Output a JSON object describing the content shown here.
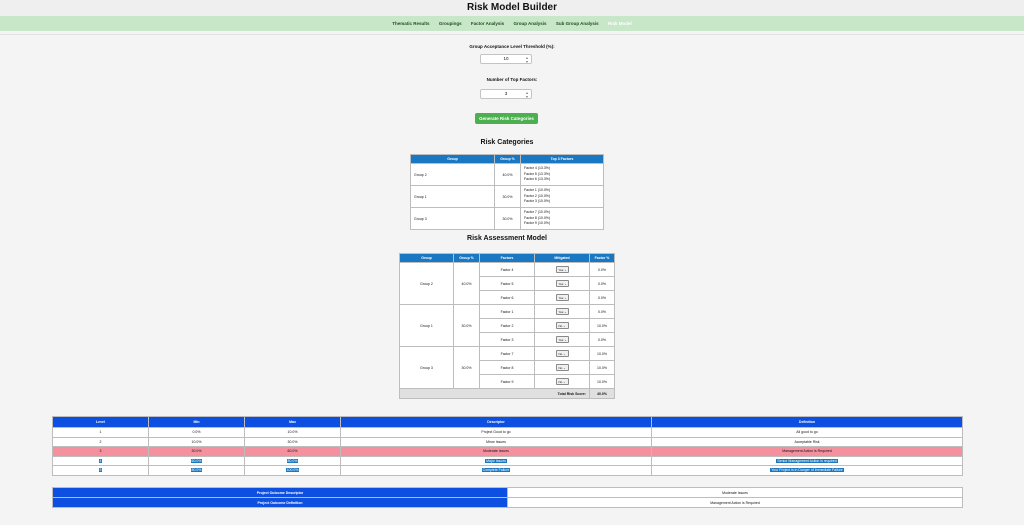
{
  "app": {
    "title": "Risk Model Builder"
  },
  "nav": {
    "tabs": [
      "Thematic Results",
      "Groupings",
      "Factor Analysis",
      "Group Analysis",
      "Sub Group Analysis",
      "Risk Model"
    ],
    "active": "Risk Model"
  },
  "form": {
    "threshold_label": "Group Acceptance Level Threshold (%):",
    "threshold_value": "10",
    "top_factors_label": "Number of Top Factors:",
    "top_factors_value": "3",
    "generate_label": "Generate Risk Categories"
  },
  "categories": {
    "title": "Risk Categories",
    "headers": [
      "Group",
      "Group %",
      "Top 3 Factors"
    ],
    "rows": [
      {
        "group": "Group 2",
        "pct": "40.0%",
        "factors": [
          "Factor 4 (13.3%)",
          "Factor 5 (13.3%)",
          "Factor 6 (13.3%)"
        ]
      },
      {
        "group": "Group 1",
        "pct": "30.0%",
        "factors": [
          "Factor 1 (10.0%)",
          "Factor 2 (10.0%)",
          "Factor 3 (10.0%)"
        ]
      },
      {
        "group": "Group 3",
        "pct": "30.0%",
        "factors": [
          "Factor 7 (10.0%)",
          "Factor 8 (10.0%)",
          "Factor 9 (10.0%)"
        ]
      }
    ]
  },
  "assessment": {
    "title": "Risk Assessment Model",
    "headers": [
      "Group",
      "Group %",
      "Factors",
      "Mitigated",
      "Factor %"
    ],
    "groups": [
      {
        "group": "Group 2",
        "pct": "40.0%",
        "factors": [
          {
            "name": "Factor 4",
            "mitigated": "Yes",
            "pct": "0.0%"
          },
          {
            "name": "Factor 5",
            "mitigated": "Yes",
            "pct": "0.0%"
          },
          {
            "name": "Factor 6",
            "mitigated": "Yes",
            "pct": "0.0%"
          }
        ]
      },
      {
        "group": "Group 1",
        "pct": "30.0%",
        "factors": [
          {
            "name": "Factor 1",
            "mitigated": "Yes",
            "pct": "0.0%"
          },
          {
            "name": "Factor 2",
            "mitigated": "No",
            "pct": "10.0%"
          },
          {
            "name": "Factor 3",
            "mitigated": "Yes",
            "pct": "0.0%"
          }
        ]
      },
      {
        "group": "Group 3",
        "pct": "30.0%",
        "factors": [
          {
            "name": "Factor 7",
            "mitigated": "No",
            "pct": "10.0%"
          },
          {
            "name": "Factor 8",
            "mitigated": "No",
            "pct": "10.0%"
          },
          {
            "name": "Factor 9",
            "mitigated": "No",
            "pct": "10.0%"
          }
        ]
      }
    ],
    "total_label": "Total Risk Score:",
    "total_value": "40.0%"
  },
  "levels": {
    "headers": [
      "Level",
      "Min",
      "Max",
      "Descriptor",
      "Definition"
    ],
    "rows": [
      [
        "1",
        "0.0%",
        "10.0%",
        "Project Good to go",
        "All good to go"
      ],
      [
        "2",
        "10.0%",
        "30.0%",
        "Minor Issues",
        "Acceptable Risk"
      ],
      [
        "3",
        "30.0%",
        "60.0%",
        "Moderate Issues",
        "Management Action is Required"
      ],
      [
        "4",
        "60.0%",
        "80.0%",
        "Major Issues",
        "Senior Management Action is required"
      ],
      [
        "5",
        "80.0%",
        "100.0%",
        "Complete Failure",
        "Your Project is in Danger of Immediate Failure"
      ]
    ],
    "highlight_row": 3
  },
  "outcome": {
    "descriptor_label": "Project Outcome Descriptor",
    "descriptor_value": "Moderate Issues",
    "definition_label": "Project Outcome Definition",
    "definition_value": "Management Action is Required"
  },
  "colors": {
    "nav_bg": "#c8e6c8",
    "button": "#4caf50",
    "table_header": "#1a78c2",
    "level_header": "#0d4fe0",
    "highlight": "#f5909f"
  }
}
